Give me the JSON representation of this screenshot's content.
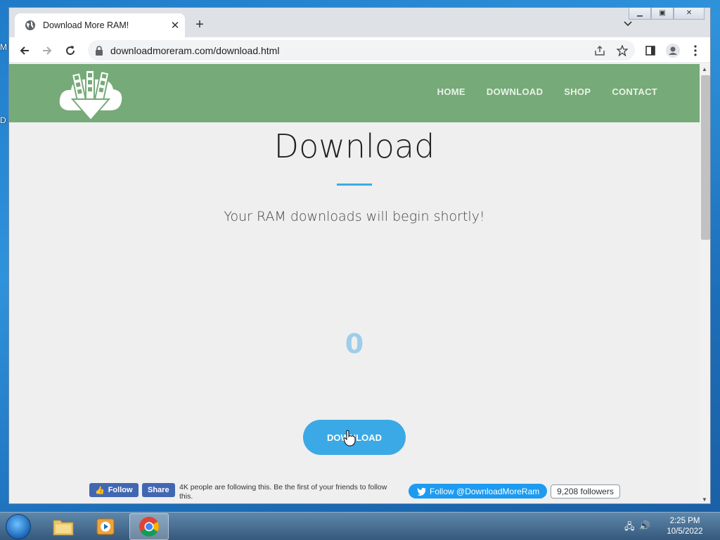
{
  "browser": {
    "tab_title": "Download More RAM!",
    "url": "downloadmoreram.com/download.html"
  },
  "site": {
    "nav": [
      "HOME",
      "DOWNLOAD",
      "SHOP",
      "CONTACT"
    ],
    "page_title": "Download",
    "subtitle": "Your RAM downloads will begin shortly!",
    "counter": "0",
    "download_button": "DOWNLOAD",
    "accent_color": "#3ba9e6",
    "header_color": "#76aa79"
  },
  "social": {
    "fb_follow": "Follow",
    "fb_share": "Share",
    "fb_text": "4K people are following this. Be the first of your friends to follow this.",
    "twitter_follow": "Follow @DownloadMoreRam",
    "twitter_followers": "9,208 followers"
  },
  "taskbar": {
    "time": "2:25 PM",
    "date": "10/5/2022"
  }
}
